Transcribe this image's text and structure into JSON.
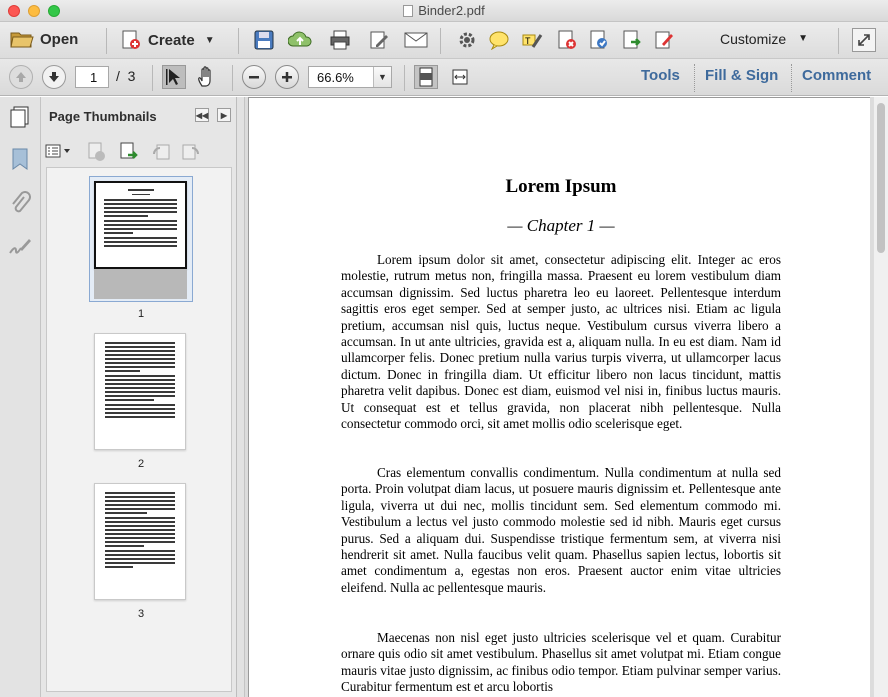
{
  "window": {
    "title": "Binder2.pdf"
  },
  "toolbar": {
    "open_label": "Open",
    "create_label": "Create",
    "customize_label": "Customize"
  },
  "nav": {
    "current_page": "1",
    "page_sep": "/",
    "page_total": "3",
    "zoom": "66.6%",
    "tools_label": "Tools",
    "fill_sign_label": "Fill & Sign",
    "comment_label": "Comment"
  },
  "panel": {
    "title": "Page Thumbnails",
    "thumbs": [
      "1",
      "2",
      "3"
    ]
  },
  "document": {
    "title": "Lorem Ipsum",
    "chapter": "— Chapter 1 —",
    "paragraphs": [
      "Lorem ipsum dolor sit amet, consectetur adipiscing elit. Integer ac eros molestie, rutrum metus non, fringilla massa. Praesent eu lorem vestibulum diam accumsan dignissim. Sed luctus pharetra leo eu laoreet. Pellentesque interdum sagittis eros eget semper. Sed at semper justo, ac ultrices nisi. Etiam ac ligula pretium, accumsan nisl quis, luctus neque. Vestibulum cursus viverra libero a accumsan. In ut ante ultricies, gravida est a, aliquam nulla. In eu est diam. Nam id ullamcorper felis. Donec pretium nulla varius turpis viverra, ut ullamcorper lacus dictum. Donec in fringilla diam. Ut efficitur libero non lacus tincidunt, mattis pharetra velit dapibus. Donec est diam, euismod vel nisi in, finibus luctus mauris. Ut consequat est et tellus gravida, non placerat nibh pellentesque. Nulla consectetur commodo orci, sit amet mollis odio scelerisque eget.",
      "Cras elementum convallis condimentum. Nulla condimentum at nulla sed porta. Proin volutpat diam lacus, ut posuere mauris dignissim et. Pellentesque ante ligula, viverra ut dui nec, mollis tincidunt sem. Sed elementum commodo mi. Vestibulum a lectus vel justo commodo molestie sed id nibh. Mauris eget cursus purus. Sed a aliquam dui. Suspendisse tristique fermentum sem, at viverra nisi hendrerit sit amet. Nulla faucibus velit quam. Phasellus sapien lectus, lobortis sit amet condimentum a, egestas non eros. Praesent auctor enim vitae ultricies eleifend. Nulla ac pellentesque mauris.",
      "Maecenas non nisl eget justo ultricies scelerisque vel et quam. Curabitur ornare quis odio sit amet vestibulum. Phasellus sit amet volutpat mi. Etiam congue mauris vitae justo dignissim, ac finibus odio tempor. Etiam pulvinar semper varius. Curabitur fermentum est et arcu lobortis"
    ]
  },
  "colors": {
    "accent": "#3e6a9c",
    "close": "#fc5753",
    "minimize": "#fdbc40",
    "maximize": "#33c748"
  },
  "icons": [
    "open-folder-icon",
    "create-pdf-icon",
    "save-icon",
    "upload-cloud-icon",
    "print-icon",
    "edit-icon",
    "email-icon",
    "gear-icon",
    "comment-bubble-icon",
    "highlight-icon",
    "delete-pdf-icon",
    "protect-icon",
    "export-icon",
    "sign-icon",
    "fullscreen-icon",
    "page-up-icon",
    "page-down-icon",
    "select-arrow-icon",
    "hand-icon",
    "zoom-out-icon",
    "zoom-in-icon",
    "fit-page-icon",
    "fit-width-icon",
    "page-thumbnails-icon",
    "bookmark-icon",
    "attachment-icon",
    "signatures-icon",
    "thumbnail-options-icon"
  ]
}
